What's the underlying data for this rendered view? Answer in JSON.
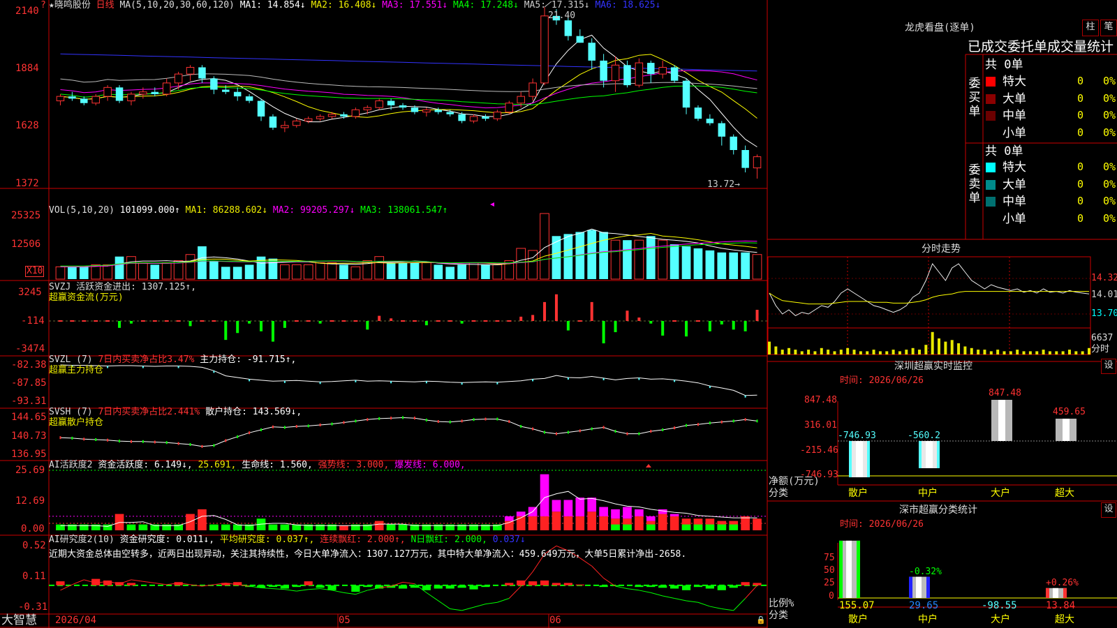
{
  "kline": {
    "star": "★",
    "name": "晓鸣股份",
    "period": "日线",
    "ma_head": "MA(5,10,20,30,60,120)",
    "ma1": "MA1: 14.854↓",
    "ma2": "MA2: 16.408↓",
    "ma3": "MA3: 17.551↓",
    "ma4": "MA4: 17.248↓",
    "ma5": "MA5: 17.315↓",
    "ma6": "MA6: 18.625↓",
    "y_ticks": [
      "2140",
      "1884",
      "1628",
      "1372"
    ],
    "high_label": "21.40",
    "low_label": "13.72→",
    "corner_mark": "?",
    "candles": [
      [
        17.2,
        17.5,
        17.0,
        17.4
      ],
      [
        17.4,
        17.6,
        17.2,
        17.3
      ],
      [
        17.3,
        17.4,
        17.0,
        17.1
      ],
      [
        17.1,
        17.5,
        17.0,
        17.4
      ],
      [
        17.4,
        17.9,
        17.2,
        17.8
      ],
      [
        17.8,
        17.9,
        17.1,
        17.2
      ],
      [
        17.2,
        17.6,
        17.0,
        17.5
      ],
      [
        17.5,
        17.8,
        17.3,
        17.6
      ],
      [
        17.6,
        17.8,
        17.4,
        17.5
      ],
      [
        17.5,
        18.2,
        17.4,
        18.0
      ],
      [
        18.0,
        18.5,
        17.7,
        18.4
      ],
      [
        18.4,
        18.8,
        18.1,
        18.7
      ],
      [
        18.7,
        18.8,
        18.0,
        18.2
      ],
      [
        18.2,
        18.3,
        17.5,
        17.7
      ],
      [
        17.7,
        17.9,
        17.5,
        17.6
      ],
      [
        17.6,
        17.8,
        17.2,
        17.4
      ],
      [
        17.4,
        17.5,
        17.1,
        17.2
      ],
      [
        17.2,
        17.3,
        16.3,
        16.5
      ],
      [
        16.5,
        16.6,
        15.9,
        16.0
      ],
      [
        16.0,
        16.3,
        15.8,
        16.1
      ],
      [
        16.1,
        16.4,
        16.0,
        16.3
      ],
      [
        16.3,
        16.5,
        16.2,
        16.4
      ],
      [
        16.4,
        16.6,
        16.3,
        16.5
      ],
      [
        16.5,
        16.7,
        16.4,
        16.6
      ],
      [
        16.6,
        16.7,
        16.4,
        16.5
      ],
      [
        16.5,
        16.9,
        16.4,
        16.8
      ],
      [
        16.8,
        17.0,
        16.6,
        16.9
      ],
      [
        16.9,
        17.3,
        16.8,
        17.2
      ],
      [
        17.2,
        17.3,
        16.8,
        17.0
      ],
      [
        17.0,
        17.1,
        16.8,
        16.9
      ],
      [
        16.9,
        17.0,
        16.6,
        16.7
      ],
      [
        16.7,
        16.9,
        16.5,
        16.8
      ],
      [
        16.8,
        16.9,
        16.6,
        16.7
      ],
      [
        16.7,
        16.8,
        16.5,
        16.6
      ],
      [
        16.6,
        16.7,
        16.2,
        16.3
      ],
      [
        16.3,
        16.6,
        16.2,
        16.5
      ],
      [
        16.5,
        16.6,
        16.3,
        16.4
      ],
      [
        16.4,
        16.8,
        16.3,
        16.7
      ],
      [
        16.7,
        17.2,
        16.6,
        17.1
      ],
      [
        17.1,
        17.6,
        16.9,
        17.4
      ],
      [
        17.4,
        18.2,
        17.2,
        18.0
      ],
      [
        18.0,
        21.4,
        17.9,
        21.0
      ],
      [
        21.0,
        21.3,
        20.6,
        20.8
      ],
      [
        20.8,
        20.9,
        19.9,
        20.1
      ],
      [
        20.1,
        20.4,
        19.8,
        19.8
      ],
      [
        19.8,
        20.0,
        18.6,
        19.0
      ],
      [
        19.0,
        19.3,
        17.8,
        18.1
      ],
      [
        18.1,
        19.2,
        17.6,
        18.8
      ],
      [
        18.8,
        19.0,
        17.8,
        17.9
      ],
      [
        17.9,
        19.1,
        17.8,
        18.9
      ],
      [
        18.9,
        19.0,
        18.0,
        18.4
      ],
      [
        18.4,
        19.0,
        18.2,
        18.7
      ],
      [
        18.7,
        18.8,
        18.0,
        18.1
      ],
      [
        18.1,
        18.2,
        16.6,
        16.9
      ],
      [
        16.9,
        17.0,
        16.3,
        16.4
      ],
      [
        16.4,
        16.6,
        16.1,
        16.2
      ],
      [
        16.2,
        16.3,
        15.2,
        15.6
      ],
      [
        15.6,
        15.7,
        14.8,
        15.0
      ],
      [
        15.0,
        15.2,
        14.0,
        14.2
      ],
      [
        14.2,
        14.8,
        13.72,
        14.7
      ]
    ]
  },
  "vol": {
    "label": "VOL(5,10,20)",
    "value": "101099.000↑",
    "ma1": "MA1: 86288.602↓",
    "ma2": "MA2: 99205.297↓",
    "ma3": "MA3: 138061.547↑",
    "y_ticks": [
      "25325",
      "12506"
    ],
    "unit": "X10",
    "values": [
      6,
      6,
      6,
      7,
      7,
      11,
      11,
      8,
      7,
      8,
      9,
      12,
      16,
      9,
      6,
      6,
      7,
      11,
      10,
      7,
      7,
      7,
      8,
      8,
      7,
      6,
      9,
      11,
      8,
      8,
      8,
      8,
      7,
      6,
      7,
      8,
      7,
      7,
      9,
      15,
      14,
      32,
      21,
      22,
      23,
      24,
      23,
      19,
      19,
      19,
      21,
      19,
      17,
      16,
      15,
      14,
      13,
      13,
      13,
      12
    ]
  },
  "svzj": {
    "label": "SVZJ  活跃资金进出: 1307.125↑,",
    "sub": "超赢资金流(万元)",
    "y_ticks": [
      "3245",
      "-114",
      "-3474"
    ],
    "values": [
      0,
      0,
      0,
      0,
      0,
      -800,
      -300,
      0,
      0,
      0,
      0,
      -600,
      0,
      0,
      -2200,
      -1400,
      -300,
      -1200,
      -2400,
      -800,
      0,
      0,
      -300,
      0,
      0,
      0,
      -1000,
      600,
      300,
      0,
      0,
      -500,
      0,
      0,
      -300,
      0,
      0,
      0,
      0,
      500,
      700,
      2200,
      3100,
      -1100,
      0,
      2200,
      -2600,
      -1300,
      1200,
      400,
      -300,
      -1700,
      0,
      -1800,
      0,
      -1200,
      -400,
      -1000,
      -1200,
      1300
    ]
  },
  "svzl": {
    "label": "SVZL (7)",
    "ratio": "7日内买卖净占比3.47%",
    "main": "主力持仓: -91.715↑,",
    "sub": "超赢主力持仓",
    "y_ticks": [
      "-82.38",
      "-87.85",
      "-93.31"
    ],
    "values": [
      -82.8,
      -82.9,
      -82.9,
      -83.0,
      -83.1,
      -83.0,
      -83.0,
      -83.1,
      -83.2,
      -83.1,
      -83.1,
      -83.2,
      -83.5,
      -84.5,
      -86.0,
      -86.5,
      -87.0,
      -87.3,
      -87.6,
      -87.5,
      -87.4,
      -87.6,
      -87.8,
      -87.7,
      -87.5,
      -87.3,
      -87.6,
      -87.5,
      -87.6,
      -87.7,
      -87.8,
      -87.6,
      -87.7,
      -87.9,
      -88.0,
      -87.9,
      -87.8,
      -87.9,
      -87.7,
      -87.5,
      -87.0,
      -86.8,
      -85.9,
      -86.5,
      -86.6,
      -86.2,
      -86.7,
      -87.2,
      -86.8,
      -86.6,
      -87.0,
      -86.9,
      -87.2,
      -87.6,
      -88.1,
      -89.0,
      -89.6,
      -90.3,
      -91.8,
      -91.7
    ]
  },
  "svsh": {
    "label": "SVSH (7)",
    "ratio": "7日内买卖净占比2.441%",
    "main": "散户持仓: 143.569↓,",
    "sub": "超赢散户持仓",
    "y_ticks": [
      "144.65",
      "140.73",
      "136.95"
    ],
    "values": [
      140.2,
      140.1,
      139.9,
      139.8,
      139.7,
      139.5,
      139.4,
      139.4,
      139.3,
      139.2,
      139.0,
      138.8,
      138.4,
      138.6,
      139.6,
      140.4,
      141.2,
      141.8,
      142.4,
      142.3,
      142.5,
      142.6,
      142.8,
      143.0,
      143.3,
      143.6,
      143.9,
      144.1,
      144.2,
      144.3,
      144.2,
      143.8,
      143.5,
      143.4,
      143.6,
      143.9,
      144.0,
      144.0,
      143.5,
      142.5,
      142.0,
      141.3,
      141.0,
      141.3,
      141.6,
      142.0,
      142.3,
      141.5,
      141.0,
      141.0,
      141.5,
      141.8,
      142.2,
      142.7,
      142.9,
      143.2,
      143.4,
      143.6,
      143.9,
      143.6
    ]
  },
  "ai_act": {
    "label": "AI活跃度2",
    "v1": "资金活跃度: 6.149↓,",
    "v2": "25.691,",
    "v3": "生命线: 1.560,",
    "v4": "强势线: 3.000,",
    "v5": "爆发线: 6.000,",
    "y_ticks": [
      "25.69",
      "12.69",
      "0.00"
    ],
    "red": [
      1,
      1,
      1,
      1,
      0,
      7,
      1,
      1,
      1,
      1,
      1,
      7,
      9,
      2,
      1,
      1,
      1,
      2,
      2,
      1,
      1,
      1,
      1,
      1,
      2,
      1,
      1,
      4,
      1,
      1,
      1,
      1,
      1,
      1,
      1,
      1,
      1,
      1,
      4,
      6,
      6,
      6,
      8,
      6,
      6,
      8,
      6,
      5,
      5,
      6,
      4,
      7,
      6,
      5,
      5,
      5,
      4,
      4,
      6,
      5
    ],
    "mag": [
      0,
      0,
      0,
      0,
      0,
      0,
      0,
      0,
      0,
      0,
      0,
      0,
      0,
      0,
      0,
      0,
      0,
      0,
      0,
      0,
      0,
      0,
      0,
      0,
      0,
      0,
      0,
      0,
      0,
      0,
      0,
      0,
      0,
      0,
      0,
      0,
      0,
      0,
      2,
      2,
      4,
      18,
      5,
      7,
      8,
      6,
      4,
      4,
      5,
      3,
      2,
      2,
      1,
      0,
      0,
      0,
      0,
      0,
      0,
      0
    ],
    "grn": [
      1,
      1,
      1,
      1,
      1,
      0,
      1,
      1,
      1,
      1,
      1,
      0,
      0,
      1,
      1,
      1,
      1,
      2,
      1,
      1,
      1,
      1,
      1,
      1,
      0,
      1,
      1,
      0,
      1,
      1,
      1,
      1,
      1,
      1,
      1,
      1,
      1,
      1,
      0,
      0,
      0,
      0,
      0,
      0,
      0,
      0,
      0,
      1,
      1,
      0,
      1,
      0,
      0,
      1,
      1,
      1,
      1,
      1,
      0,
      0
    ]
  },
  "ai_res": {
    "label": "AI研究度2(10)",
    "v1": "资金研究度: 0.011↓,",
    "v2": "平均研究度: 0.037↑,",
    "v3": "连续飘红: 2.000↑,",
    "v4": "N日飘红: 2.000,",
    "v5": "0.037↓",
    "comment": "近期大资金总体由空转多，近两日出现异动，关注其持续性，今日大单净流入：1307.127万元，其中特大单净流入：459.649万元，大单5日累计净出-2658.",
    "y_ticks": [
      "0.52",
      "0.11",
      "-0.31"
    ],
    "bars": [
      0.05,
      0,
      0,
      0.08,
      0.06,
      0.04,
      0.03,
      0,
      0,
      0,
      0.04,
      0,
      0,
      0,
      0.03,
      0.04,
      -0.02,
      -0.03,
      -0.02,
      -0.04,
      -0.02,
      0.05,
      -0.03,
      -0.06,
      0,
      -0.08,
      -0.02,
      -0.04,
      -0.03,
      -0.04,
      -0.03,
      -0.06,
      -0.04,
      -0.04,
      -0.03,
      -0.05,
      -0.02,
      0,
      0.03,
      0.06,
      0.05,
      0.06,
      0.03,
      0.03,
      0.01,
      0,
      -0.02,
      -0.01,
      0,
      -0.02,
      -0.02,
      -0.03,
      -0.04,
      -0.06,
      -0.02,
      -0.04,
      -0.06,
      -0.03,
      0.04,
      0.03
    ],
    "line": [
      -0.05,
      0.02,
      0.08,
      0.04,
      0.06,
      0.03,
      0.08,
      0.06,
      0.04,
      0.02,
      0.04,
      0.02,
      0.0,
      0.02,
      0.04,
      0.02,
      0.0,
      -0.02,
      -0.03,
      -0.04,
      -0.06,
      -0.04,
      -0.03,
      -0.05,
      -0.08,
      -0.1,
      -0.05,
      -0.02,
      0.0,
      0.05,
      0.03,
      -0.08,
      -0.18,
      -0.28,
      -0.3,
      -0.26,
      -0.22,
      -0.2,
      -0.15,
      0.0,
      0.18,
      0.4,
      0.5,
      0.44,
      0.35,
      0.25,
      0.1,
      0.0,
      -0.03,
      -0.05,
      -0.08,
      -0.12,
      -0.15,
      -0.18,
      -0.2,
      -0.25,
      -0.28,
      -0.3,
      -0.15,
      0.01
    ]
  },
  "xaxis": {
    "brand": "大智慧",
    "date_start": "2026/04",
    "m1": "05",
    "m2": "06"
  },
  "right": {
    "lhb_title": "龙虎看盘(逐单)",
    "btn_zhu": "柱",
    "btn_bi": "笔",
    "stats_title": "已成交委托单成交量统计",
    "buy": {
      "header": "共 0单",
      "side": "委买单",
      "rows": [
        {
          "label": "特大",
          "n": "0",
          "p": "0%"
        },
        {
          "label": "大单",
          "n": "0",
          "p": "0%"
        },
        {
          "label": "中单",
          "n": "0",
          "p": "0%"
        },
        {
          "label": "小单",
          "n": "0",
          "p": "0%"
        }
      ]
    },
    "sell": {
      "header": "共 0单",
      "side": "委卖单",
      "rows": [
        {
          "label": "特大",
          "n": "0",
          "p": "0%"
        },
        {
          "label": "大单",
          "n": "0",
          "p": "0%"
        },
        {
          "label": "中单",
          "n": "0",
          "p": "0%"
        },
        {
          "label": "小单",
          "n": "0",
          "p": "0%"
        }
      ]
    },
    "fenshi": {
      "title": "分时走势",
      "p1": "14.32",
      "p2": "14.01",
      "p3": "13.70",
      "vol": "6637",
      "tag": "分时",
      "price": [
        14.05,
        13.9,
        13.8,
        13.85,
        13.78,
        13.82,
        13.8,
        13.85,
        13.9,
        13.88,
        13.95,
        14.05,
        14.1,
        14.05,
        14.0,
        13.95,
        13.9,
        13.88,
        13.85,
        13.82,
        13.85,
        13.9,
        14.0,
        14.05,
        14.2,
        14.4,
        14.3,
        14.2,
        14.35,
        14.4,
        14.3,
        14.2,
        14.15,
        14.1,
        14.15,
        14.12,
        14.1,
        14.08,
        14.1,
        14.06,
        14.08,
        14.05,
        14.1,
        14.06,
        14.07,
        14.05,
        14.08,
        14.06,
        14.05,
        14.04
      ],
      "avg": [
        14.05,
        14.0,
        13.96,
        13.95,
        13.94,
        13.93,
        13.92,
        13.92,
        13.92,
        13.92,
        13.93,
        13.94,
        13.95,
        13.95,
        13.95,
        13.95,
        13.94,
        13.94,
        13.94,
        13.93,
        13.93,
        13.93,
        13.94,
        13.95,
        13.97,
        14.0,
        14.02,
        14.03,
        14.04,
        14.06,
        14.07,
        14.07,
        14.07,
        14.07,
        14.07,
        14.07,
        14.07,
        14.07,
        14.07,
        14.07,
        14.07,
        14.07,
        14.07,
        14.07,
        14.07,
        14.07,
        14.07,
        14.07,
        14.07,
        14.07
      ],
      "vols": [
        8,
        5,
        3,
        4,
        3,
        2,
        3,
        2,
        4,
        3,
        2,
        3,
        4,
        3,
        2,
        2,
        3,
        2,
        2,
        3,
        2,
        3,
        4,
        3,
        6,
        14,
        10,
        8,
        9,
        7,
        5,
        4,
        3,
        3,
        2,
        3,
        2,
        2,
        3,
        2,
        2,
        2,
        3,
        2,
        2,
        2,
        3,
        2,
        2,
        4
      ]
    },
    "sz_monitor": {
      "title": "深圳超赢实时监控",
      "btn": "设",
      "time": "时间: 2026/06/26",
      "y_ticks": [
        "847.48",
        "316.01",
        "-215.46",
        "-746.93"
      ],
      "ylabel": "净额(万元)",
      "xlabel": "分类",
      "cats": [
        "散户",
        "中户",
        "大户",
        "超大"
      ],
      "values": [
        -746.93,
        -560.2,
        847.48,
        459.65
      ],
      "labels": [
        "-746.93",
        "-560.2",
        "847.48",
        "459.65"
      ]
    },
    "sz_class": {
      "title": "深市超赢分类统计",
      "btn": "设",
      "time": "时间: 2026/06/26",
      "y_ticks": [
        "75",
        "50",
        "25",
        "0"
      ],
      "ylabel": "比例%",
      "xlabel": "分类",
      "cats": [
        "散户",
        "中户",
        "大户",
        "超大"
      ],
      "values": [
        155.07,
        29.65,
        -98.55,
        13.84
      ],
      "bottom_labels": [
        "155.07",
        "29.65",
        "-98.55",
        "13.84"
      ],
      "top_labels": [
        "",
        "-0.32%",
        "",
        "+0.26%"
      ]
    }
  }
}
